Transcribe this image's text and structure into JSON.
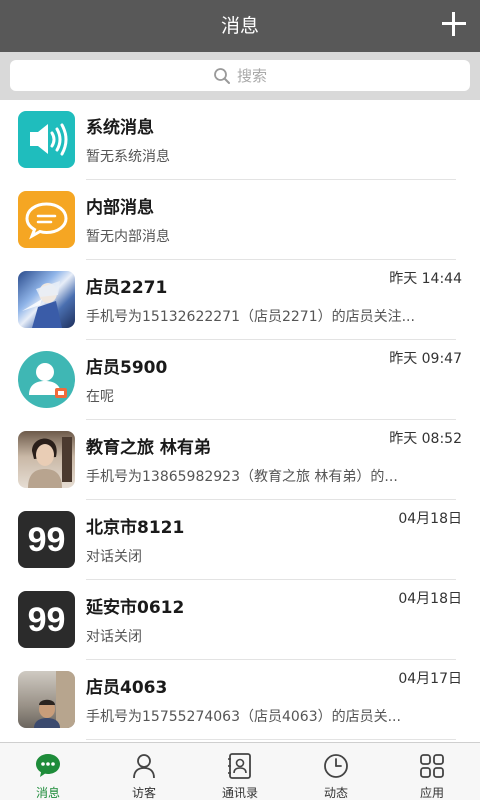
{
  "header": {
    "title": "消息"
  },
  "search": {
    "placeholder": "搜索"
  },
  "messages": [
    {
      "title": "系统消息",
      "subtitle": "暂无系统消息",
      "time": ""
    },
    {
      "title": "内部消息",
      "subtitle": "暂无内部消息",
      "time": ""
    },
    {
      "title": "店员2271",
      "subtitle": "手机号为15132622271（店员2271）的店员关注...",
      "time": "昨天 14:44"
    },
    {
      "title": "店员5900",
      "subtitle": "在呢",
      "time": "昨天 09:47"
    },
    {
      "title": "教育之旅 林有弟",
      "subtitle": "手机号为13865982923（教育之旅 林有弟）的...",
      "time": "昨天 08:52"
    },
    {
      "title": "北京市8121",
      "subtitle": "对话关闭",
      "time": "04月18日"
    },
    {
      "title": "延安市0612",
      "subtitle": "对话关闭",
      "time": "04月18日"
    },
    {
      "title": "店员4063",
      "subtitle": "手机号为15755274063（店员4063）的店员关...",
      "time": "04月17日"
    }
  ],
  "avatars": {
    "ninety_nine": "99"
  },
  "tabs": [
    {
      "label": "消息",
      "icon": "chat-bubble-icon",
      "active": true
    },
    {
      "label": "访客",
      "icon": "person-icon",
      "active": false
    },
    {
      "label": "通讯录",
      "icon": "contacts-icon",
      "active": false
    },
    {
      "label": "动态",
      "icon": "clock-icon",
      "active": false
    },
    {
      "label": "应用",
      "icon": "apps-grid-icon",
      "active": false
    }
  ],
  "colors": {
    "header": "#585858",
    "active_tab": "#1e8c3a",
    "system_avatar": "#1fbdbd",
    "internal_avatar": "#f5a623"
  }
}
